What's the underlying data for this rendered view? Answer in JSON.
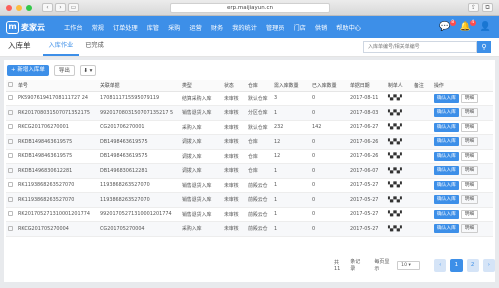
{
  "browser": {
    "url": "erp.maijiayun.cn"
  },
  "app": {
    "logo_text": "麦家云",
    "logo_mark": "m",
    "menu": [
      "工作台",
      "常规",
      "订单处理",
      "库管",
      "采购",
      "运营",
      "财务",
      "我的统计",
      "管理员",
      "门店",
      "供销",
      "帮助中心"
    ],
    "notif_count": "4",
    "msg_count": "8"
  },
  "page": {
    "title": "入库单",
    "tabs": [
      "入库作业",
      "已完成"
    ],
    "active_tab": 0
  },
  "search": {
    "placeholder": "入库单编号/相关单编号"
  },
  "toolbar": {
    "new_label": "+ 新增入库单",
    "export_label": "导出",
    "download_label": "⬇ ▾"
  },
  "table": {
    "columns": [
      "单号",
      "关联单据",
      "类型",
      "状态",
      "仓库",
      "需入库数量",
      "已入库数量",
      "单据日期",
      "制单人",
      "备注",
      "操作"
    ],
    "rows": [
      {
        "no": "PK590761941708111727 24",
        "ref": "1708111715595079119",
        "type": "结算采购入库",
        "status": "未审核",
        "wh": "默认仓库",
        "need": "3",
        "done": "0",
        "date": "2017-08-11"
      },
      {
        "no": "RK201708031507071352175",
        "ref": "9920170803150707135217 5",
        "type": "销售退货入库",
        "status": "未审核",
        "wh": "分区仓库",
        "need": "1",
        "done": "0",
        "date": "2017-08-03"
      },
      {
        "no": "RKCG201706270001",
        "ref": "CG201706270001",
        "type": "采购入库",
        "status": "未审核",
        "wh": "默认仓库",
        "need": "232",
        "done": "142",
        "date": "2017-06-27"
      },
      {
        "no": "RKDB1498463619575",
        "ref": "DB1498463619575",
        "type": "调拨入库",
        "status": "未审核",
        "wh": "仓库",
        "need": "12",
        "done": "0",
        "date": "2017-06-26"
      },
      {
        "no": "RKDB1498463619575",
        "ref": "DB1498463619575",
        "type": "调拨入库",
        "status": "未审核",
        "wh": "仓库",
        "need": "12",
        "done": "0",
        "date": "2017-06-26"
      },
      {
        "no": "RKDB1496830612281",
        "ref": "DB1496830612281",
        "type": "调拨入库",
        "status": "未审核",
        "wh": "仓库",
        "need": "1",
        "done": "0",
        "date": "2017-06-07"
      },
      {
        "no": "RK1193868263527070",
        "ref": "1193868263527070",
        "type": "销售退货入库",
        "status": "未审核",
        "wh": "前殿云仓",
        "need": "1",
        "done": "0",
        "date": "2017-05-27"
      },
      {
        "no": "RK1193868263527070",
        "ref": "1193868263527070",
        "type": "销售退货入库",
        "status": "未审核",
        "wh": "前殿云仓",
        "need": "1",
        "done": "0",
        "date": "2017-05-27"
      },
      {
        "no": "RK201705271310001201774",
        "ref": "99201705271310001201774",
        "type": "销售退货入库",
        "status": "未审核",
        "wh": "前殿云仓",
        "need": "1",
        "done": "0",
        "date": "2017-05-27"
      },
      {
        "no": "RKCG201705270004",
        "ref": "CG201705270004",
        "type": "采购入库",
        "status": "未审核",
        "wh": "前殿云仓",
        "need": "1",
        "done": "0",
        "date": "2017-05-27"
      }
    ],
    "confirm_label": "确认入库",
    "detail_label": "明细"
  },
  "pagination": {
    "summary": "共 11",
    "per_page_label": "条记录",
    "page_size_label": "每页显示",
    "page_size": "10",
    "pages": [
      "1",
      "2"
    ],
    "current": "1",
    "prev": "‹",
    "next": "›"
  },
  "colors": {
    "brand": "#3d8fe8",
    "badge": "#ff4b4b"
  }
}
